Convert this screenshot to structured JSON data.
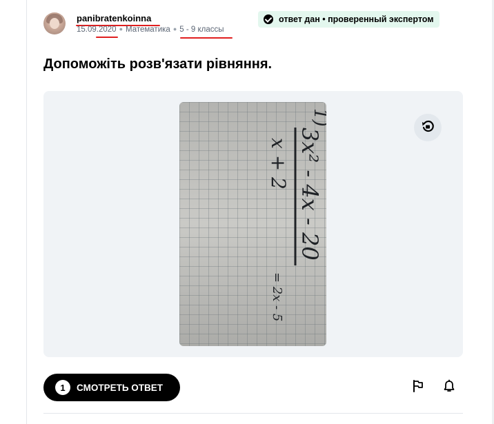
{
  "question": {
    "author": "panibratenkoinna",
    "date": "15.09.2020",
    "subject": "Математика",
    "grade": "5 - 9 классы",
    "badge_text": "ответ дан • проверенный экспертом",
    "title": "Допоможіть розв'язати рівняння.",
    "attachment": {
      "handwriting_line1": "1)",
      "handwriting_numerator": "3x² - 4x - 20",
      "handwriting_denominator": "x + 2",
      "handwriting_rhs": "= 2x - 5"
    }
  },
  "actions": {
    "answers_count": "1",
    "view_answer_label": "СМОТРЕТЬ ОТВЕТ"
  },
  "icons": {
    "badge": "verified-check-icon",
    "rotate": "rotate-icon",
    "report": "flag-icon",
    "follow": "bell-icon"
  },
  "colors": {
    "badge_bg": "#e3f7ee",
    "attachment_bg": "#f0f3f6",
    "primary_button": "#000000",
    "annotation_red": "#e01e1e"
  }
}
